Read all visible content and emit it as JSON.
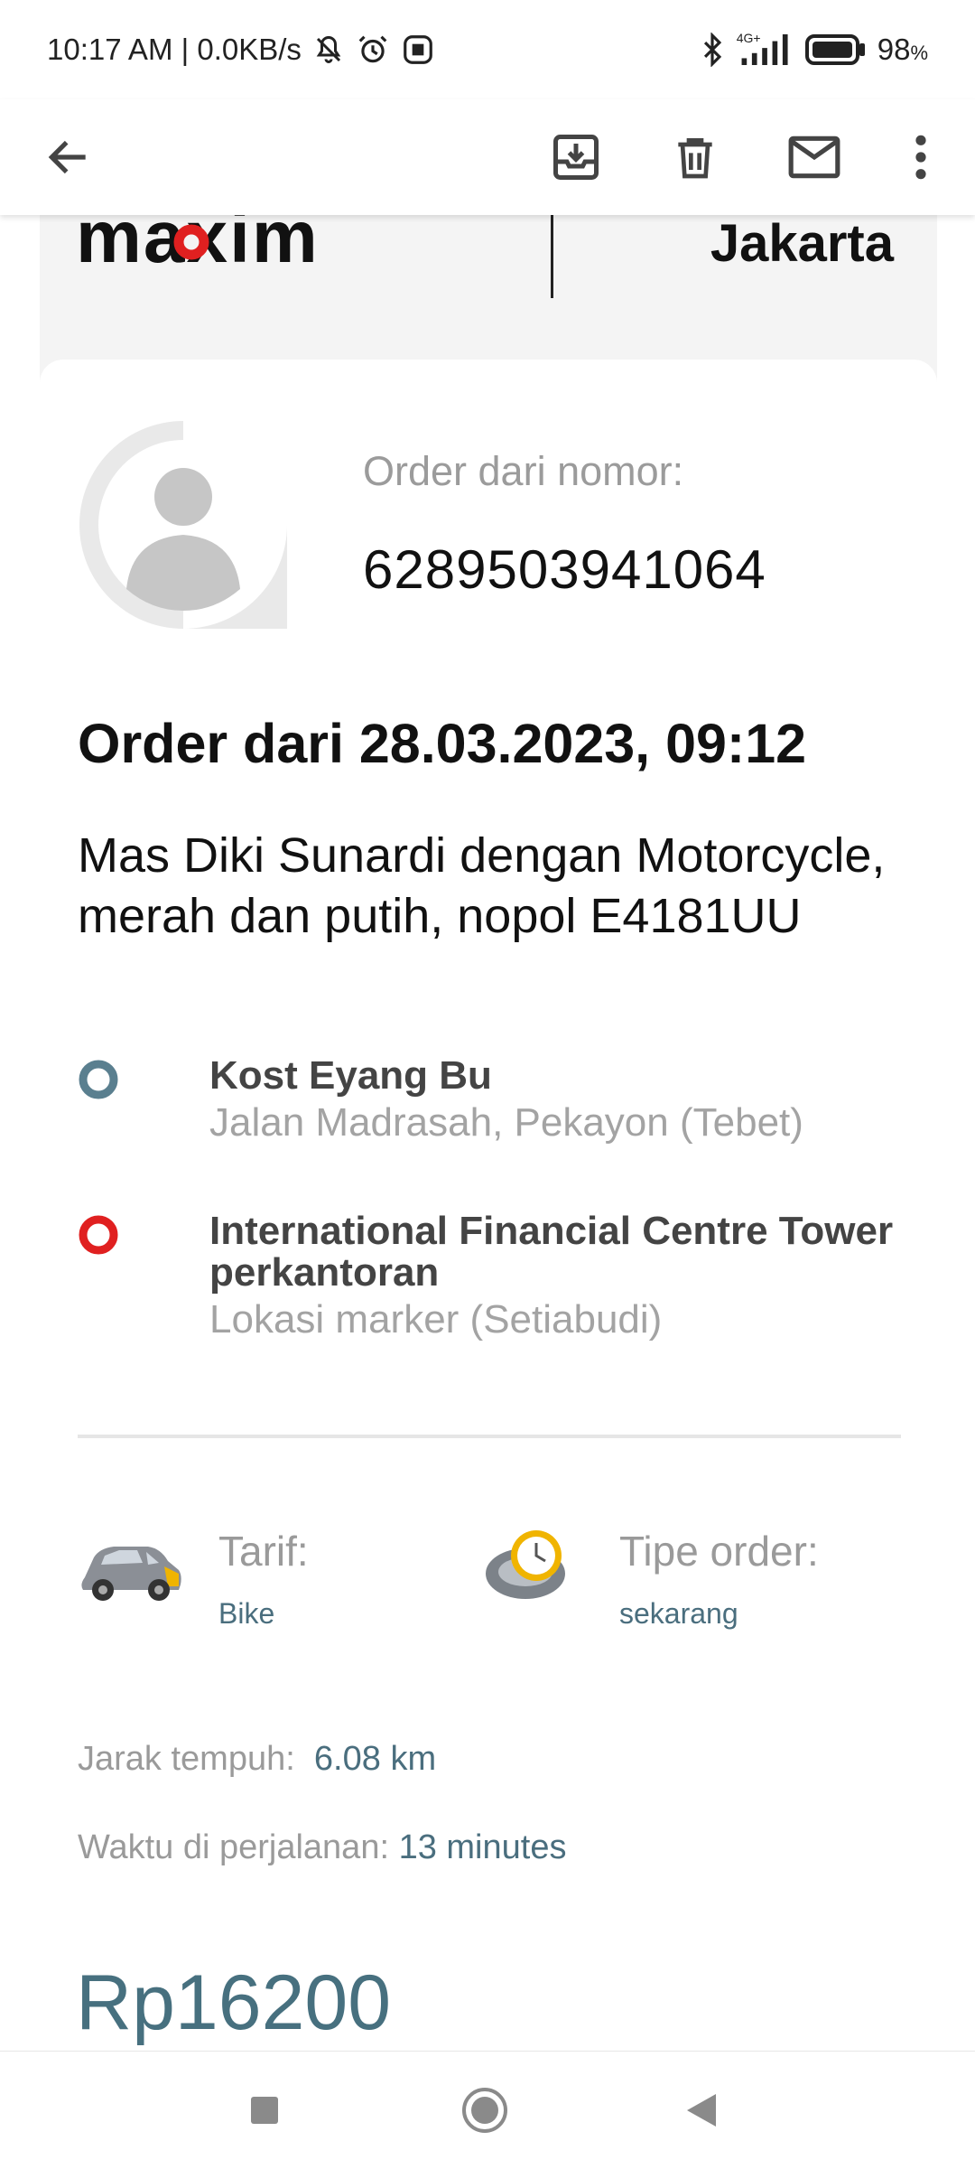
{
  "status_bar": {
    "time_speed": "10:17 AM | 0.0KB/s",
    "network": "4G+",
    "battery": "98",
    "battery_unit": "%"
  },
  "app_bar": {
    "icons": [
      "arrow-back-icon",
      "archive-icon",
      "delete-icon",
      "mail-icon",
      "more-vert-icon"
    ]
  },
  "email": {
    "brand": "maxim",
    "city": "Jakarta",
    "order_label": "Order dari nomor:",
    "order_phone": "6289503941064",
    "order_title": "Order dari 28.03.2023, 09:12",
    "driver_info": "Mas Diki Sunardi dengan Motorcycle, merah dan putih, nopol E4181UU",
    "route": [
      {
        "name": "Kost Eyang Bu",
        "sub": "Jalan Madrasah, Pekayon (Tebet)",
        "color": "#5a7f8f"
      },
      {
        "name": "International Financial Centre Tower perkantoran",
        "sub": "Lokasi marker (Setiabudi)",
        "color": "#e02020"
      }
    ],
    "tariff_label": "Tarif:",
    "tariff_value": "Bike",
    "order_type_label": "Tipe order:",
    "order_type_value": "sekarang",
    "distance_label": "Jarak tempuh:",
    "distance_value": "6.08 km",
    "travel_label": "Waktu di perjalanan:",
    "travel_value": "13 minutes",
    "price": "Rp16200"
  },
  "colors": {
    "accent": "#47707f",
    "brand_red": "#e02020",
    "muted": "#9a9a9a"
  }
}
